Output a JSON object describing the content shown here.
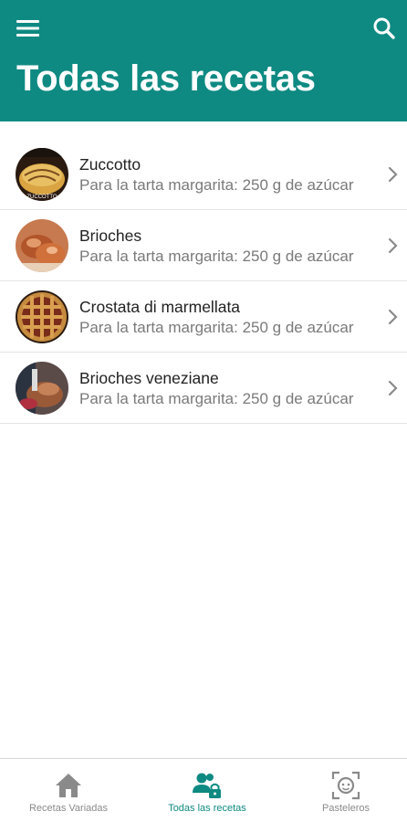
{
  "header": {
    "title": "Todas las recetas",
    "background": "#0e8a82",
    "menu_icon": "hamburger-menu-icon",
    "search_icon": "search-icon"
  },
  "recipes": [
    {
      "title": "Zuccotto",
      "subtitle": "Para la tarta margarita: 250 g de azúcar",
      "thumb_text": "ZUCCOTTO"
    },
    {
      "title": "Brioches",
      "subtitle": "Para la tarta margarita: 250 g de azúcar"
    },
    {
      "title": "Crostata di marmellata",
      "subtitle": "Para la tarta margarita: 250 g de azúcar"
    },
    {
      "title": "Brioches veneziane",
      "subtitle": "Para la tarta margarita: 250 g de azúcar"
    }
  ],
  "bottom_nav": {
    "items": [
      {
        "label": "Recetas Variadas",
        "icon": "home-icon",
        "active": false
      },
      {
        "label": "Todas las recetas",
        "icon": "users-lock-icon",
        "active": true
      },
      {
        "label": "Pasteleros",
        "icon": "face-scan-icon",
        "active": false
      }
    ],
    "active_color": "#0e8a82",
    "inactive_color": "#8a8a8a"
  }
}
